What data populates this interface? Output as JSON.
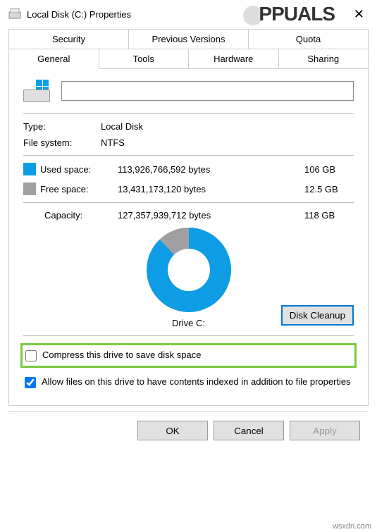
{
  "window": {
    "title": "Local Disk (C:) Properties"
  },
  "tabs": {
    "top": [
      "Security",
      "Previous Versions",
      "Quota"
    ],
    "bottom": [
      "General",
      "Tools",
      "Hardware",
      "Sharing"
    ],
    "active": "General"
  },
  "general": {
    "name_value": "",
    "type_label": "Type:",
    "type_value": "Local Disk",
    "fs_label": "File system:",
    "fs_value": "NTFS",
    "used_label": "Used space:",
    "used_bytes": "113,926,766,592 bytes",
    "used_hr": "106 GB",
    "free_label": "Free space:",
    "free_bytes": "13,431,173,120 bytes",
    "free_hr": "12.5 GB",
    "capacity_label": "Capacity:",
    "capacity_bytes": "127,357,939,712 bytes",
    "capacity_hr": "118 GB",
    "drive_label": "Drive C:",
    "cleanup_button": "Disk Cleanup",
    "compress_label": "Compress this drive to save disk space",
    "compress_checked": false,
    "index_label": "Allow files on this drive to have contents indexed in addition to file properties",
    "index_checked": true
  },
  "buttons": {
    "ok": "OK",
    "cancel": "Cancel",
    "apply": "Apply"
  },
  "watermark": {
    "brand": "PPUALS",
    "url": "wsxdn.com"
  },
  "colors": {
    "used": "#0e9de5",
    "free": "#a0a0a0",
    "highlight": "#7ac943",
    "focus": "#0078d7"
  }
}
